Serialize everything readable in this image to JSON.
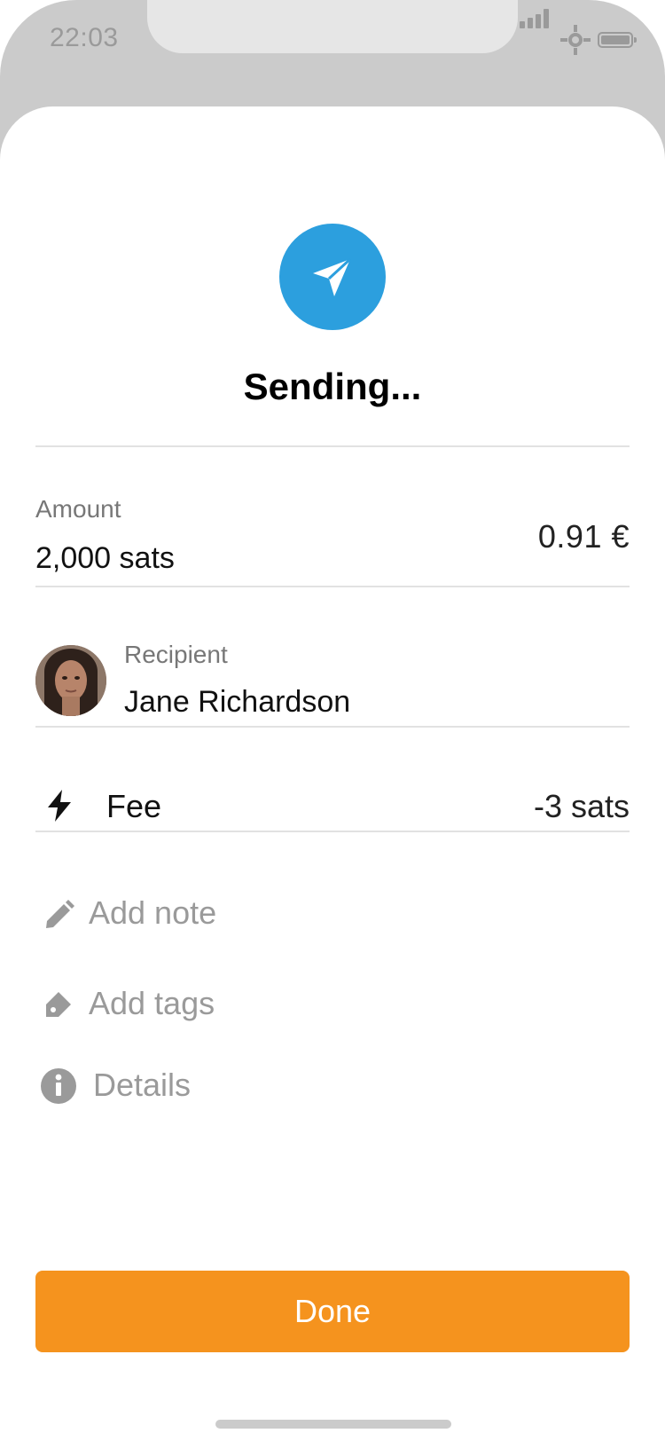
{
  "status_bar": {
    "time": "22:03",
    "icons": [
      "signal-icon",
      "wifi-icon",
      "battery-icon"
    ]
  },
  "screen": {
    "title": "Sending...",
    "header_icon": "paper-plane-icon",
    "accent_color": "#2c9fde"
  },
  "amount": {
    "label": "Amount",
    "value": "2,000 sats",
    "fiat": "0.91 €"
  },
  "recipient": {
    "label": "Recipient",
    "name": "Jane Richardson",
    "avatar": "avatar-photo"
  },
  "fee": {
    "icon": "lightning-icon",
    "label": "Fee",
    "value": "-3 sats"
  },
  "actions": [
    {
      "icon": "pencil-icon",
      "label": "Add note"
    },
    {
      "icon": "tag-icon",
      "label": "Add tags"
    },
    {
      "icon": "info-icon",
      "label": "Details"
    }
  ],
  "done_button": {
    "label": "Done",
    "color": "#f5931e"
  }
}
